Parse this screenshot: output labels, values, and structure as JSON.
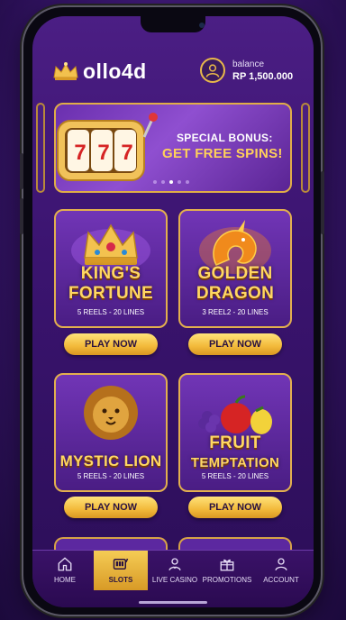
{
  "header": {
    "brand": "ollo4d",
    "balance_label": "balance",
    "balance_value": "RP 1,500.000"
  },
  "banner": {
    "line1": "SPECIAL BONUS:",
    "line2": "GET FREE SPINS!",
    "slot_symbols": [
      "7",
      "7",
      "7"
    ]
  },
  "games": [
    {
      "title_line1": "KING'S",
      "title_line2": "FORTUNE",
      "subtitle": "5 REELS - 20 LINES",
      "button": "PLAY NOW",
      "icon": "crown-icon"
    },
    {
      "title_line1": "GOLDEN",
      "title_line2": "DRAGON",
      "subtitle": "3 REEL2 - 20 LINES",
      "button": "PLAY NOW",
      "icon": "dragon-icon"
    },
    {
      "title_line1": "MYSTIC LION",
      "title_line2": "",
      "subtitle": "5 REELS - 20 LINES",
      "button": "PLAY NOW",
      "icon": "lion-icon"
    },
    {
      "title_line1": "FRUIT",
      "title_line2": "TEMPTATION",
      "subtitle": "5 REELS - 20 LINES",
      "button": "PLAY NOW",
      "icon": "fruit-icon"
    }
  ],
  "nav": {
    "items": [
      {
        "label": "HOME",
        "icon": "home-icon"
      },
      {
        "label": "SLOTS",
        "icon": "slot-machine-icon",
        "active": true
      },
      {
        "label": "LIVE CASINO",
        "icon": "dealer-icon"
      },
      {
        "label": "PROMOTIONS",
        "icon": "gift-icon"
      },
      {
        "label": "ACCOUNT",
        "icon": "user-icon"
      }
    ]
  },
  "colors": {
    "gold": "#e3b04e",
    "purple_bg": "#3b1470",
    "title_gold": "#ffd763"
  }
}
